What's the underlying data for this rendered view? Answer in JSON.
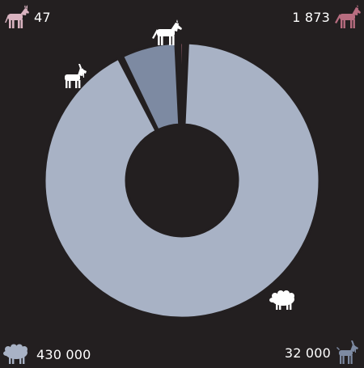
{
  "colors": {
    "background": "#231f20",
    "sheep": "#a8b2c5",
    "goat": "#7d8aa2",
    "horse": "#b86d80",
    "donkey": "#d9b3c0",
    "icon_light": "#ffffff"
  },
  "legend": {
    "donkey": {
      "value_label": "47",
      "icon": "donkey-icon"
    },
    "horse": {
      "value_label": "1 873",
      "icon": "horse-icon"
    },
    "sheep": {
      "value_label": "430 000",
      "icon": "sheep-icon"
    },
    "goat": {
      "value_label": "32 000",
      "icon": "goat-icon"
    }
  },
  "chart_data": {
    "type": "pie",
    "donut": true,
    "series": [
      {
        "name": "sheep",
        "value": 430000,
        "icon": "sheep-icon",
        "color": "#a8b2c5"
      },
      {
        "name": "goat",
        "value": 32000,
        "icon": "goat-icon",
        "color": "#7d8aa2"
      },
      {
        "name": "horse",
        "value": 1873,
        "icon": "horse-icon",
        "color": "#b86d80"
      },
      {
        "name": "donkey",
        "value": 47,
        "icon": "donkey-icon",
        "color": "#d9b3c0"
      }
    ]
  }
}
